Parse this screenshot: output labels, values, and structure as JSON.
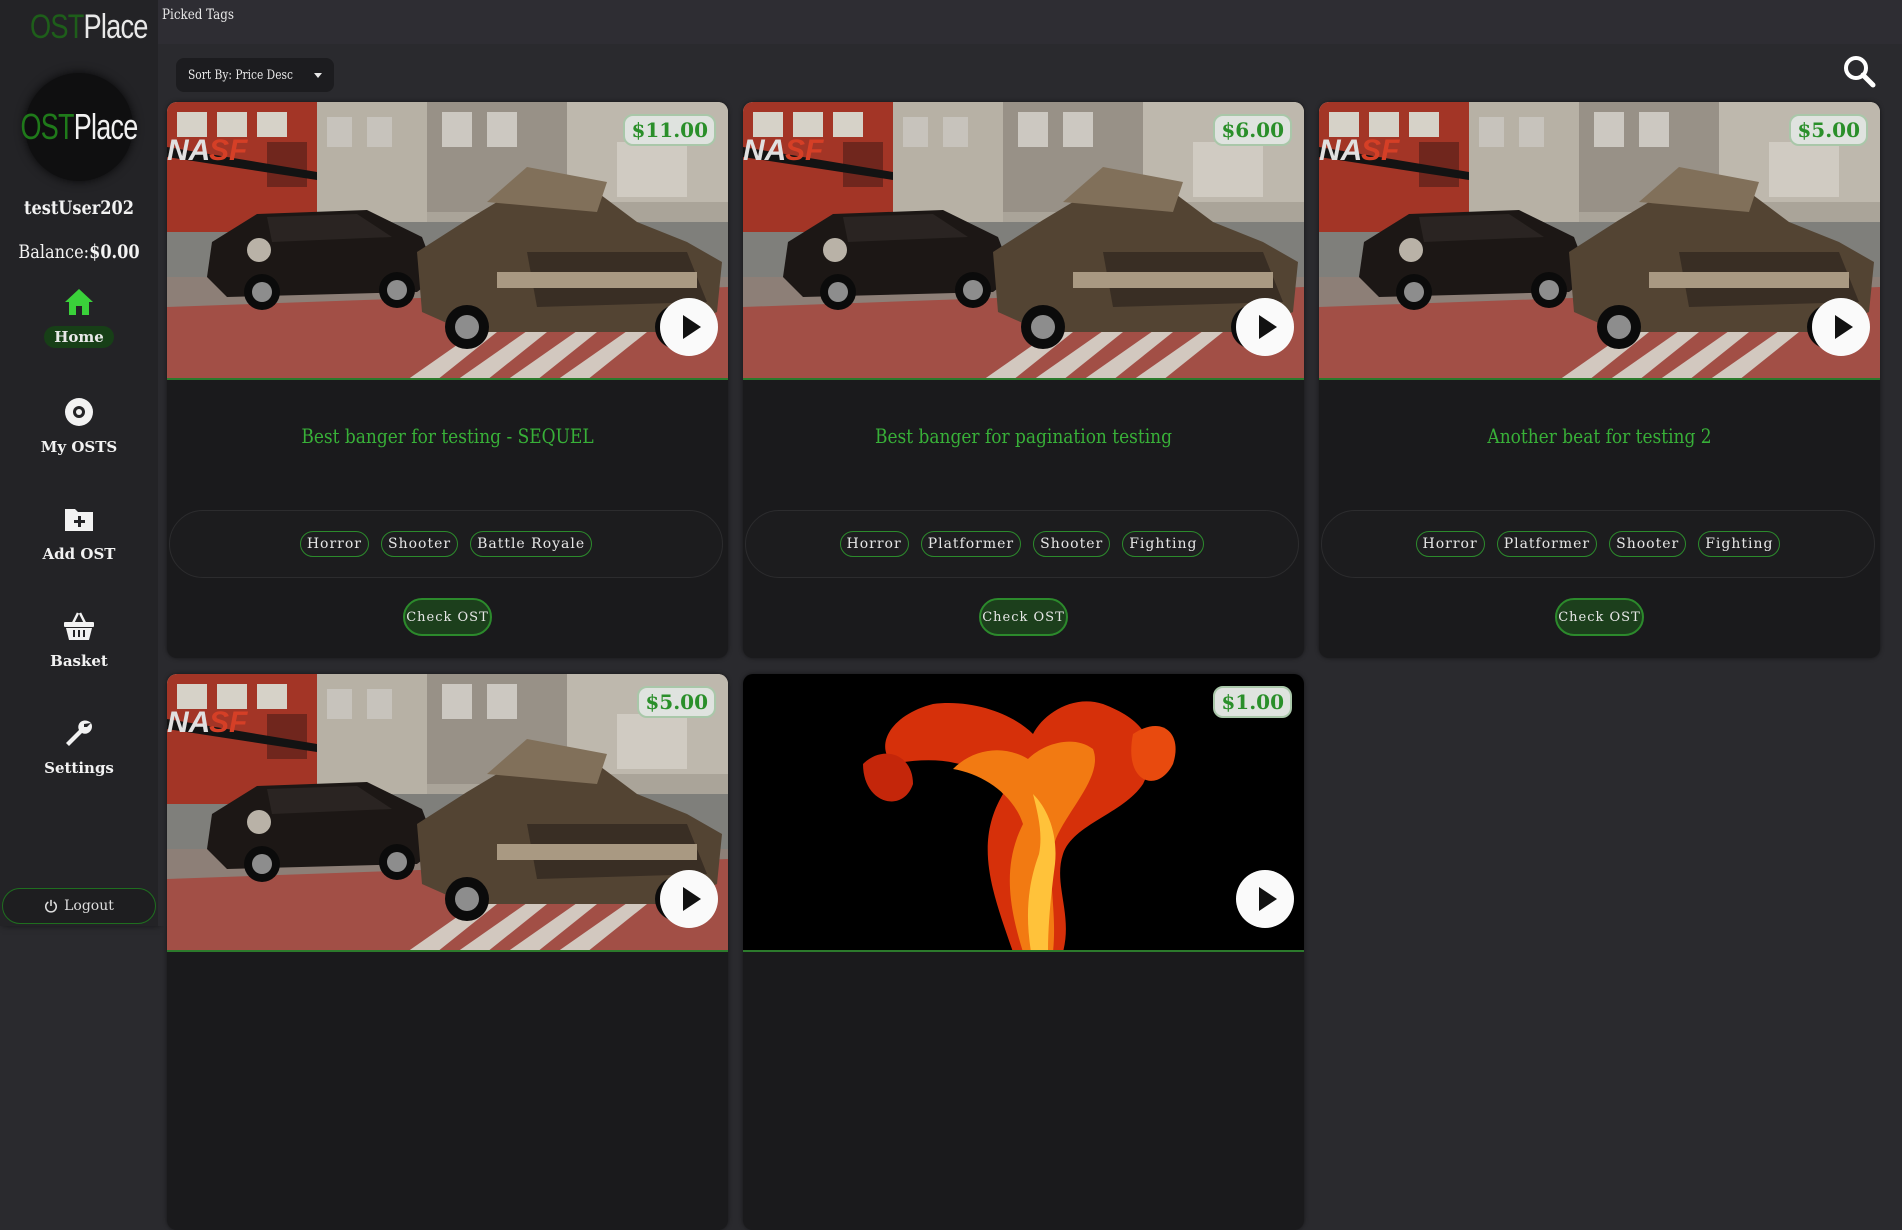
{
  "header": {
    "title": "Picked Tags"
  },
  "sidebar": {
    "logo": {
      "ost": "OST",
      "place": "Place"
    },
    "username": "testUser202",
    "balance_label": "Balance:",
    "balance_value": "$0.00",
    "nav": [
      {
        "label": "Home",
        "icon": "home-icon",
        "active": true
      },
      {
        "label": "My OSTS",
        "icon": "disc-icon"
      },
      {
        "label": "Add OST",
        "icon": "add-folder-icon"
      },
      {
        "label": "Basket",
        "icon": "basket-icon"
      },
      {
        "label": "Settings",
        "icon": "wrench-icon"
      }
    ],
    "logout_label": "Logout"
  },
  "toolbar": {
    "sort_label": "Sort By: Price Desc"
  },
  "colors": {
    "accent": "#38b038",
    "sidebar": "#232326",
    "background": "#2a2a2e"
  },
  "cards": [
    {
      "price": "$11.00",
      "title": "Best banger for testing - SEQUEL",
      "tags": [
        "Horror",
        "Shooter",
        "Battle Royale"
      ],
      "button": "Check OST",
      "image": "lowrider-street"
    },
    {
      "price": "$6.00",
      "title": "Best banger for pagination testing",
      "tags": [
        "Horror",
        "Platformer",
        "Shooter",
        "Fighting"
      ],
      "button": "Check OST",
      "image": "lowrider-street"
    },
    {
      "price": "$5.00",
      "title": "Another beat for testing 2",
      "tags": [
        "Horror",
        "Platformer",
        "Shooter",
        "Fighting"
      ],
      "button": "Check OST",
      "image": "lowrider-street"
    },
    {
      "price": "$5.00",
      "image": "lowrider-street"
    },
    {
      "price": "$1.00",
      "image": "fire"
    }
  ]
}
